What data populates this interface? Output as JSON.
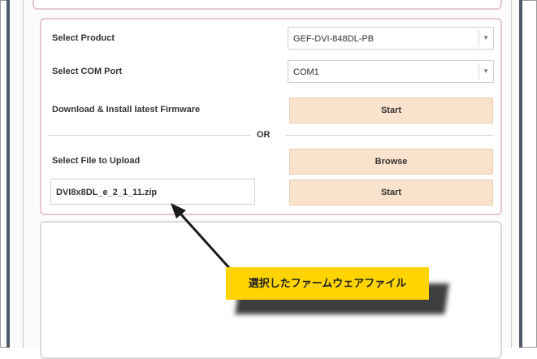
{
  "form": {
    "select_product": {
      "label": "Select Product",
      "value": "GEF-DVI-848DL-PB"
    },
    "select_com_port": {
      "label": "Select COM Port",
      "value": "COM1"
    },
    "download_install": {
      "label": "Download & Install latest Firmware",
      "button_label": "Start"
    },
    "or_label": "OR",
    "upload": {
      "label": "Select File to Upload",
      "browse_label": "Browse",
      "file_name": "DVI8x8DL_e_2_1_11.zip",
      "start_label": "Start"
    }
  },
  "annotation": {
    "callout_text": "選択したファームウェアファイル",
    "callout_color": "#ffd400"
  },
  "colors": {
    "button_bg": "#fae3cc",
    "panel_border": "#e6c9cf",
    "frame": "#4d5a6a"
  }
}
